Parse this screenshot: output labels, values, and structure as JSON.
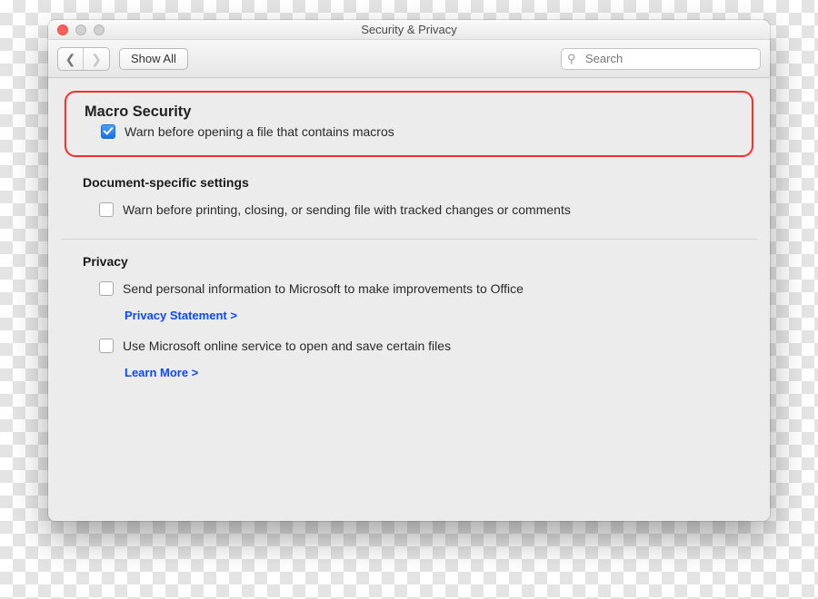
{
  "window": {
    "title": "Security & Privacy"
  },
  "toolbar": {
    "show_all": "Show All",
    "search_placeholder": "Search"
  },
  "sections": {
    "macro": {
      "heading": "Macro Security",
      "warn_macros": {
        "label": "Warn before opening a file that contains macros",
        "checked": true
      }
    },
    "docspec": {
      "heading": "Document-specific settings",
      "warn_tracked": {
        "label": "Warn before printing, closing, or sending file with tracked changes or comments",
        "checked": false
      }
    },
    "privacy": {
      "heading": "Privacy",
      "send_info": {
        "label": "Send personal information to Microsoft to make improvements to Office",
        "checked": false
      },
      "privacy_statement": "Privacy Statement >",
      "online_service": {
        "label": "Use Microsoft online service to open and save certain files",
        "checked": false
      },
      "learn_more": "Learn More >"
    }
  }
}
